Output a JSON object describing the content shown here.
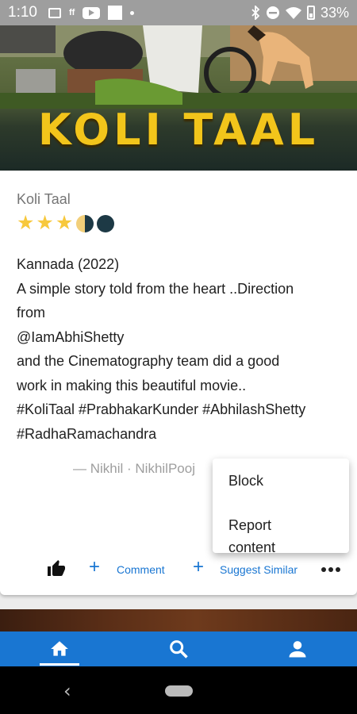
{
  "status_bar": {
    "time": "1:10",
    "battery": "33%"
  },
  "hero": {
    "title": "KOLI TAAL"
  },
  "post": {
    "movie_title": "Koli Taal",
    "rating_stars": 3.5,
    "rating_max": 5,
    "review_lines": [
      "Kannada (2022)",
      "A simple story told from the heart ..Direction",
      "from",
      "@IamAbhiShetty",
      "and the Cinematography team did a good",
      "work in making this beautiful movie..",
      "#KoliTaal #PrabhakarKunder #AbhilashShetty",
      "#RadhaRamachandra"
    ],
    "attribution": "— Nikhil · NikhilPooj"
  },
  "actions": {
    "comment_label": "Comment",
    "suggest_label": "Suggest Similar"
  },
  "popup_menu": {
    "items": [
      "Block",
      "Report content"
    ]
  },
  "colors": {
    "accent": "#1976d2",
    "star": "#f7c83c",
    "hero_title": "#f2c51b"
  },
  "bottom_nav": {
    "items": [
      "home-icon",
      "search-icon",
      "profile-icon"
    ],
    "active": "home-icon"
  }
}
